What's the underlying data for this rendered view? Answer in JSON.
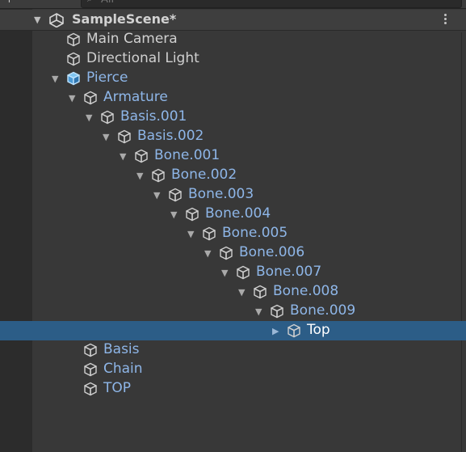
{
  "toolbar": {
    "search_placeholder": "All",
    "add_icon": "plus-icon",
    "dropdown_icon": "chevron-down-icon",
    "search_icon": "search-icon"
  },
  "scene": {
    "name": "SampleScene*",
    "icon": "unity-logo-icon",
    "menu_icon": "kebab-menu-icon"
  },
  "colors": {
    "background": "#383838",
    "selection": "#2c5d87",
    "prefab_text": "#8eb6e8",
    "plain_text": "#d0d0d0"
  },
  "hierarchy": [
    {
      "label": "Main Camera",
      "depth": 0,
      "fold": "none",
      "kind": "plain"
    },
    {
      "label": "Directional Light",
      "depth": 0,
      "fold": "none",
      "kind": "plain"
    },
    {
      "label": "Pierce",
      "depth": 0,
      "fold": "open",
      "kind": "prefab-root"
    },
    {
      "label": "Armature",
      "depth": 1,
      "fold": "open",
      "kind": "prefab"
    },
    {
      "label": "Basis.001",
      "depth": 2,
      "fold": "open",
      "kind": "prefab"
    },
    {
      "label": "Basis.002",
      "depth": 3,
      "fold": "open",
      "kind": "prefab"
    },
    {
      "label": "Bone.001",
      "depth": 4,
      "fold": "open",
      "kind": "prefab"
    },
    {
      "label": "Bone.002",
      "depth": 5,
      "fold": "open",
      "kind": "prefab"
    },
    {
      "label": "Bone.003",
      "depth": 6,
      "fold": "open",
      "kind": "prefab"
    },
    {
      "label": "Bone.004",
      "depth": 7,
      "fold": "open",
      "kind": "prefab"
    },
    {
      "label": "Bone.005",
      "depth": 8,
      "fold": "open",
      "kind": "prefab"
    },
    {
      "label": "Bone.006",
      "depth": 9,
      "fold": "open",
      "kind": "prefab"
    },
    {
      "label": "Bone.007",
      "depth": 10,
      "fold": "open",
      "kind": "prefab"
    },
    {
      "label": "Bone.008",
      "depth": 11,
      "fold": "open",
      "kind": "prefab"
    },
    {
      "label": "Bone.009",
      "depth": 12,
      "fold": "open",
      "kind": "prefab"
    },
    {
      "label": "Top",
      "depth": 13,
      "fold": "closed",
      "kind": "prefab",
      "selected": true
    },
    {
      "label": "Basis",
      "depth": 1,
      "fold": "none",
      "kind": "prefab"
    },
    {
      "label": "Chain",
      "depth": 1,
      "fold": "none",
      "kind": "prefab"
    },
    {
      "label": "TOP",
      "depth": 1,
      "fold": "none",
      "kind": "prefab"
    }
  ]
}
